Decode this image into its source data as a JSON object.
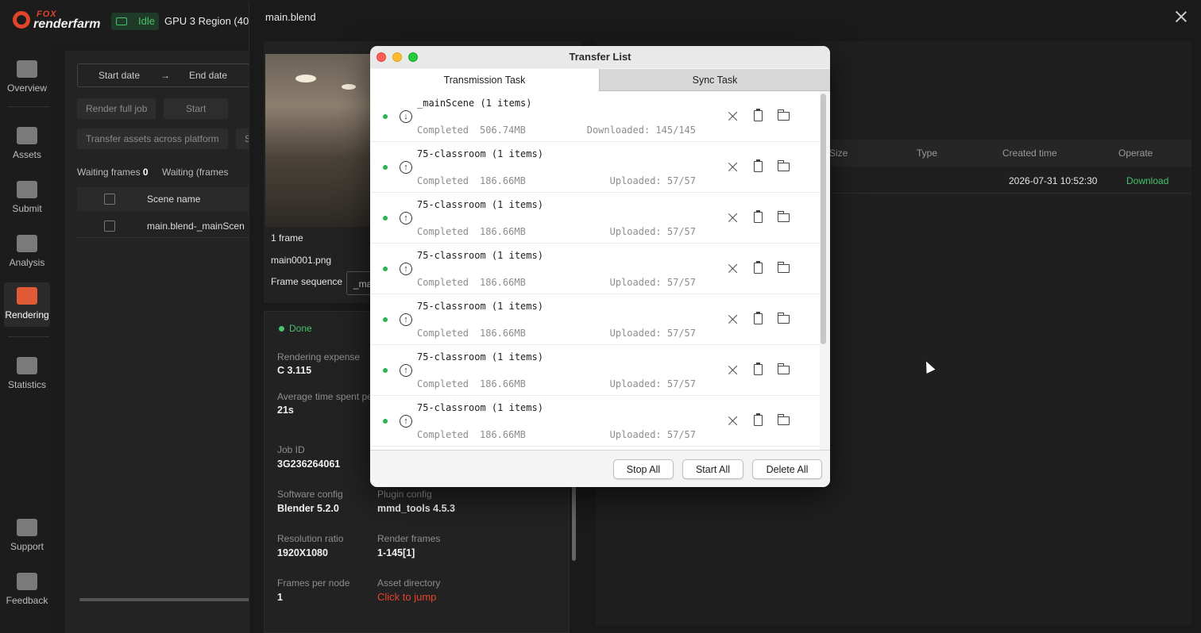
{
  "app": {
    "brand_top": "FOX",
    "brand_bottom": "renderfarm",
    "status": "Idle",
    "region": "GPU 3 Region  (40"
  },
  "nav": [
    {
      "label": "Overview",
      "icon": "pulse-icon"
    },
    {
      "label": "Assets",
      "icon": "folder-icon"
    },
    {
      "label": "Submit",
      "icon": "upload-icon"
    },
    {
      "label": "Analysis",
      "icon": "analysis-icon"
    },
    {
      "label": "Rendering",
      "icon": "rendering-icon",
      "active": true
    },
    {
      "label": "Statistics",
      "icon": "bar-chart-icon"
    },
    {
      "label": "Support",
      "icon": "document-icon"
    },
    {
      "label": "Feedback",
      "icon": "feedback-icon"
    }
  ],
  "job_list": {
    "start_date": "Start date",
    "arrow": "→",
    "end_date": "End date",
    "btn_render_full": "Render full job",
    "btn_start": "Start",
    "btn_transfer": "Transfer assets across platform",
    "btn_s": "S",
    "waiting_frames_label": "Waiting frames",
    "waiting_frames_count": "0",
    "waiting_frames2": "Waiting (frames",
    "col_scene": "Scene name",
    "row_scene": "main.blend-_mainScen"
  },
  "detail": {
    "title": "main.blend",
    "frames": "1 frame",
    "file": "main0001.png",
    "frame_seq_label": "Frame sequence",
    "frame_seq_value": "_ma",
    "status": "Done",
    "expense_label": "Rendering expense",
    "expense_value": "C 3.115",
    "avg_label": "Average time spent pe",
    "avg_value": "21s",
    "job_id_label": "Job ID",
    "job_id_value": "3G236264061",
    "software_label": "Software config",
    "software_value": "Blender 5.2.0",
    "plugin_label": "Plugin config",
    "plugin_value": "mmd_tools 4.5.3",
    "res_label": "Resolution ratio",
    "res_value": "1920X1080",
    "frames_label": "Render frames",
    "frames_value": "1-145[1]",
    "fpn_label": "Frames per node",
    "fpn_value": "1",
    "asset_label": "Asset directory",
    "asset_value": "Click to jump"
  },
  "output_table": {
    "col_size": "Size",
    "col_type": "Type",
    "col_created": "Created time",
    "col_operate": "Operate",
    "row_created": "2026-07-31 10:52:30",
    "row_action": "Download"
  },
  "dialog": {
    "title": "Transfer List",
    "tab_transmission": "Transmission Task",
    "tab_sync": "Sync Task",
    "tasks": [
      {
        "name": "_mainScene  (1 items)",
        "direction": "download",
        "status": "Completed",
        "size": "506.74MB",
        "progress": "Downloaded: 145/145"
      },
      {
        "name": "75-classroom  (1 items)",
        "direction": "upload",
        "status": "Completed",
        "size": "186.66MB",
        "progress": "Uploaded: 57/57"
      },
      {
        "name": "75-classroom  (1 items)",
        "direction": "upload",
        "status": "Completed",
        "size": "186.66MB",
        "progress": "Uploaded: 57/57"
      },
      {
        "name": "75-classroom  (1 items)",
        "direction": "upload",
        "status": "Completed",
        "size": "186.66MB",
        "progress": "Uploaded: 57/57"
      },
      {
        "name": "75-classroom  (1 items)",
        "direction": "upload",
        "status": "Completed",
        "size": "186.66MB",
        "progress": "Uploaded: 57/57"
      },
      {
        "name": "75-classroom  (1 items)",
        "direction": "upload",
        "status": "Completed",
        "size": "186.66MB",
        "progress": "Uploaded: 57/57"
      },
      {
        "name": "75-classroom  (1 items)",
        "direction": "upload",
        "status": "Completed",
        "size": "186.66MB",
        "progress": "Uploaded: 57/57"
      }
    ],
    "btn_stop_all": "Stop All",
    "btn_start_all": "Start All",
    "btn_delete_all": "Delete All"
  },
  "colors": {
    "accent": "#e0452a",
    "success": "#46c26b"
  }
}
